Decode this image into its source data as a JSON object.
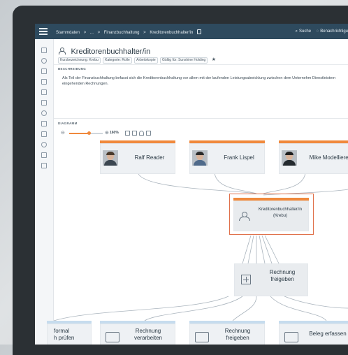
{
  "topbar": {
    "breadcrumb": [
      "Stammdaten",
      ">",
      "...",
      ">",
      "Finanzbuchhaltung",
      ">",
      "Kreditorenbuchhalter/in"
    ],
    "search_label": "Suche",
    "notifications_label": "Benachrichtigu"
  },
  "page": {
    "title": "Kreditorenbuchhalter/in",
    "meta": [
      "Kurzbezeichnung: Krebu",
      "Kategorie: Rolle",
      "Arbeitskopie",
      "Gültig für: Sunshine Holding"
    ],
    "section_description": "BESCHREIBUNG",
    "description": "Als Teil der Finanzbuchhaltung befasst sich die Kreditorenbuchhaltung vor allem mit der laufenden Leistungsabwicklung zwischen dem Unternehm Dienstleistern eingehenden Rechnungen.",
    "section_diagram": "DIAGRAMM"
  },
  "toolbar": {
    "zoom_level": "160%",
    "zoom_fraction": 0.6
  },
  "diagram": {
    "people": [
      {
        "name": "Ralf Reader"
      },
      {
        "name": "Frank Lispel"
      },
      {
        "name": "Mike Modellierer"
      }
    ],
    "role": {
      "line1": "Kreditorenbuchhalter/in",
      "line2": "(Krebu)"
    },
    "process": {
      "line1": "Rechnung",
      "line2": "freigeben"
    },
    "tasks": [
      {
        "line1": "formal",
        "line2": "h prüfen"
      },
      {
        "line1": "Rechnung",
        "line2": "verarbeiten"
      },
      {
        "line1": "Rechnung",
        "line2": "freigeben"
      },
      {
        "line1": "Beleg erfassen",
        "line2": ""
      }
    ]
  },
  "colors": {
    "accent": "#f0893c",
    "topbar": "#2e4a5e",
    "focus": "#e0704a"
  }
}
